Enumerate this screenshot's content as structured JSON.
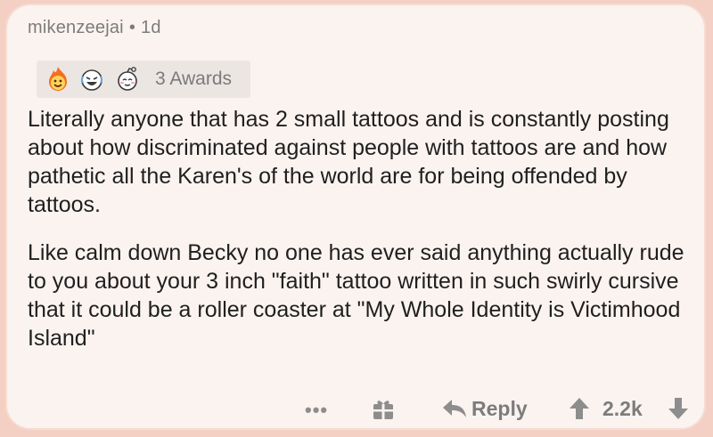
{
  "comment": {
    "author": "mikenzeejai",
    "separator": "•",
    "age": "1d",
    "awards": {
      "icons": [
        "fire-face-award-icon",
        "laughing-face-award-icon",
        "wholesome-award-icon"
      ],
      "label": "3 Awards"
    },
    "paragraphs": [
      "Literally anyone that has 2 small tattoos and is constantly posting about how discriminated against people with tattoos are and how pathetic all the Karen's of the world are for being offended by tattoos.",
      "Like calm down Becky no one has ever said anything actually rude to you about your 3 inch \"faith\" tattoo written in such swirly cursive that it could be a roller coaster at \"My Whole Identity is Victimhood Island\""
    ]
  },
  "actions": {
    "more": "•••",
    "reply": "Reply",
    "score": "2.2k"
  },
  "colors": {
    "background": "#f3d0c3",
    "card": "#fbf3f0",
    "text": "#1f1f1f",
    "muted": "#7c7c7c"
  }
}
